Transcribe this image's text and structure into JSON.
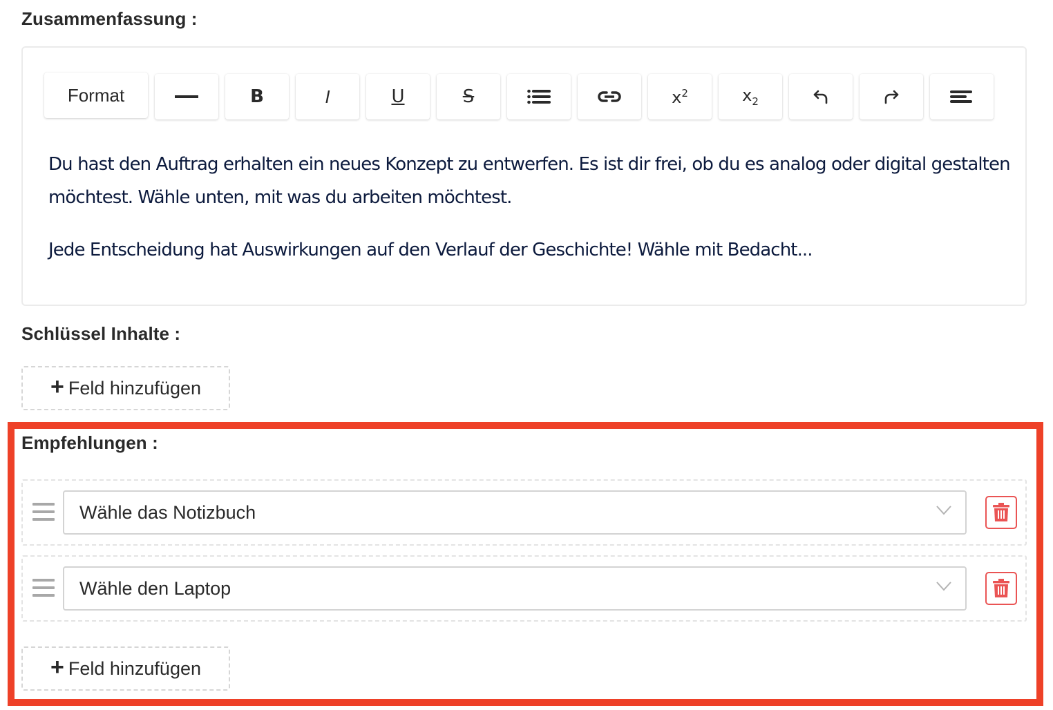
{
  "summary": {
    "label": "Zusammenfassung :",
    "toolbar": {
      "format_label": "Format",
      "buttons": [
        {
          "name": "horizontal-rule",
          "icon": "horizontal-rule-icon"
        },
        {
          "name": "bold",
          "icon": "bold-icon",
          "glyph": "B"
        },
        {
          "name": "italic",
          "icon": "italic-icon",
          "glyph": "I"
        },
        {
          "name": "underline",
          "icon": "underline-icon",
          "glyph": "U"
        },
        {
          "name": "strikethrough",
          "icon": "strikethrough-icon",
          "glyph": "S"
        },
        {
          "name": "bulleted-list",
          "icon": "list-icon"
        },
        {
          "name": "link",
          "icon": "link-icon"
        },
        {
          "name": "superscript",
          "icon": "superscript-icon",
          "glyph": "x",
          "sup": "2"
        },
        {
          "name": "subscript",
          "icon": "subscript-icon",
          "glyph": "x",
          "sub": "2"
        },
        {
          "name": "undo",
          "icon": "undo-icon"
        },
        {
          "name": "redo",
          "icon": "redo-icon"
        },
        {
          "name": "align",
          "icon": "align-left-icon"
        }
      ]
    },
    "paragraphs": [
      "Du hast den Auftrag erhalten ein neues Konzept zu entwerfen. Es ist dir frei, ob du es analog oder digital gestalten möchtest. Wähle unten, mit was du arbeiten möchtest.",
      "Jede Entscheidung hat Auswirkungen auf den Verlauf der Geschichte! Wähle mit Bedacht..."
    ]
  },
  "key_contents": {
    "label": "Schlüssel Inhalte :",
    "add_button": {
      "icon": "+",
      "label": "Feld hinzufügen"
    }
  },
  "recommendations": {
    "label": "Empfehlungen :",
    "items": [
      {
        "value": "Wähle das Notizbuch"
      },
      {
        "value": "Wähle den Laptop"
      }
    ],
    "add_button": {
      "icon": "+",
      "label": "Feld hinzufügen"
    }
  },
  "colors": {
    "highlight": "#ee4128",
    "delete": "#ea5454",
    "editor_text": "#0c1a3d"
  }
}
